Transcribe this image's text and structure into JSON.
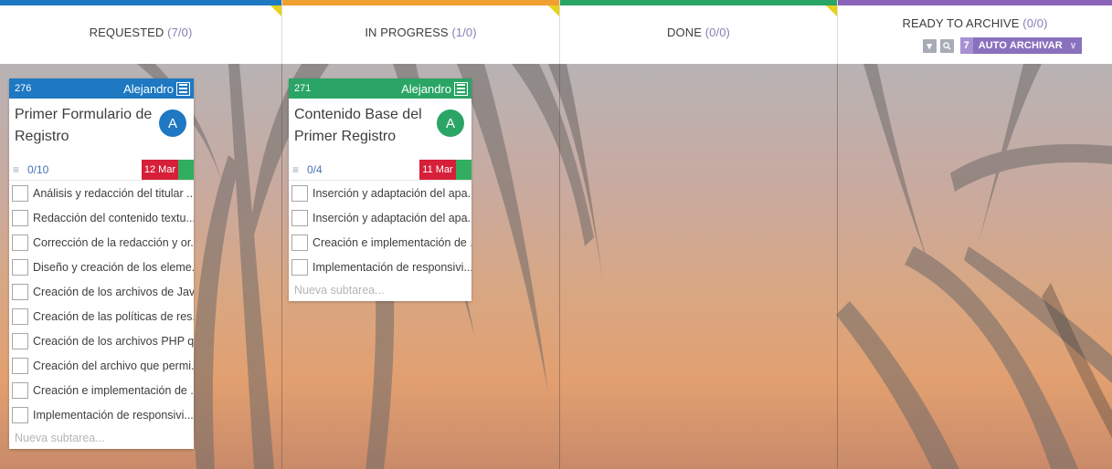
{
  "columns": [
    {
      "name": "REQUESTED",
      "count": "(7/0)",
      "color": "#1e78c2"
    },
    {
      "name": "IN PROGRESS",
      "count": "(1/0)",
      "color": "#f0a030"
    },
    {
      "name": "DONE",
      "count": "(0/0)",
      "color": "#2aa566"
    },
    {
      "name": "READY TO ARCHIVE",
      "count": "(0/0)",
      "color": "#8a63b8"
    }
  ],
  "archive": {
    "auto_count": "7",
    "auto_label": "AUTO ARCHIVAR",
    "icons": [
      "collapse-icon",
      "search-icon",
      "chevron-down-icon"
    ]
  },
  "cards": [
    {
      "id": "276",
      "owner": "Alejandro",
      "title": "Primer Formulario de Registro",
      "avatar": "A",
      "progress": "0/10",
      "date": "12 Mar",
      "color": "#1e78c2",
      "subtasks": [
        "Análisis y redacción del titular ...",
        "Redacción del contenido textu...",
        "Corrección de la redacción y or...",
        "Diseño y creación de los eleme...",
        "Creación de los archivos de Jav...",
        "Creación de las políticas de res...",
        "Creación de los archivos PHP q...",
        "Creación del archivo que permi...",
        "Creación e implementación de ...",
        "Implementación de responsivi..."
      ],
      "new_subtask_placeholder": "Nueva subtarea..."
    },
    {
      "id": "271",
      "owner": "Alejandro",
      "title": "Contenido Base del Primer Registro",
      "avatar": "A",
      "progress": "0/4",
      "date": "11 Mar",
      "color": "#2aa566",
      "subtasks": [
        "Inserción y adaptación del apa...",
        "Inserción y adaptación del apa...",
        "Creación e implementación de ...",
        "Implementación de responsivi..."
      ],
      "new_subtask_placeholder": "Nueva subtarea..."
    }
  ]
}
